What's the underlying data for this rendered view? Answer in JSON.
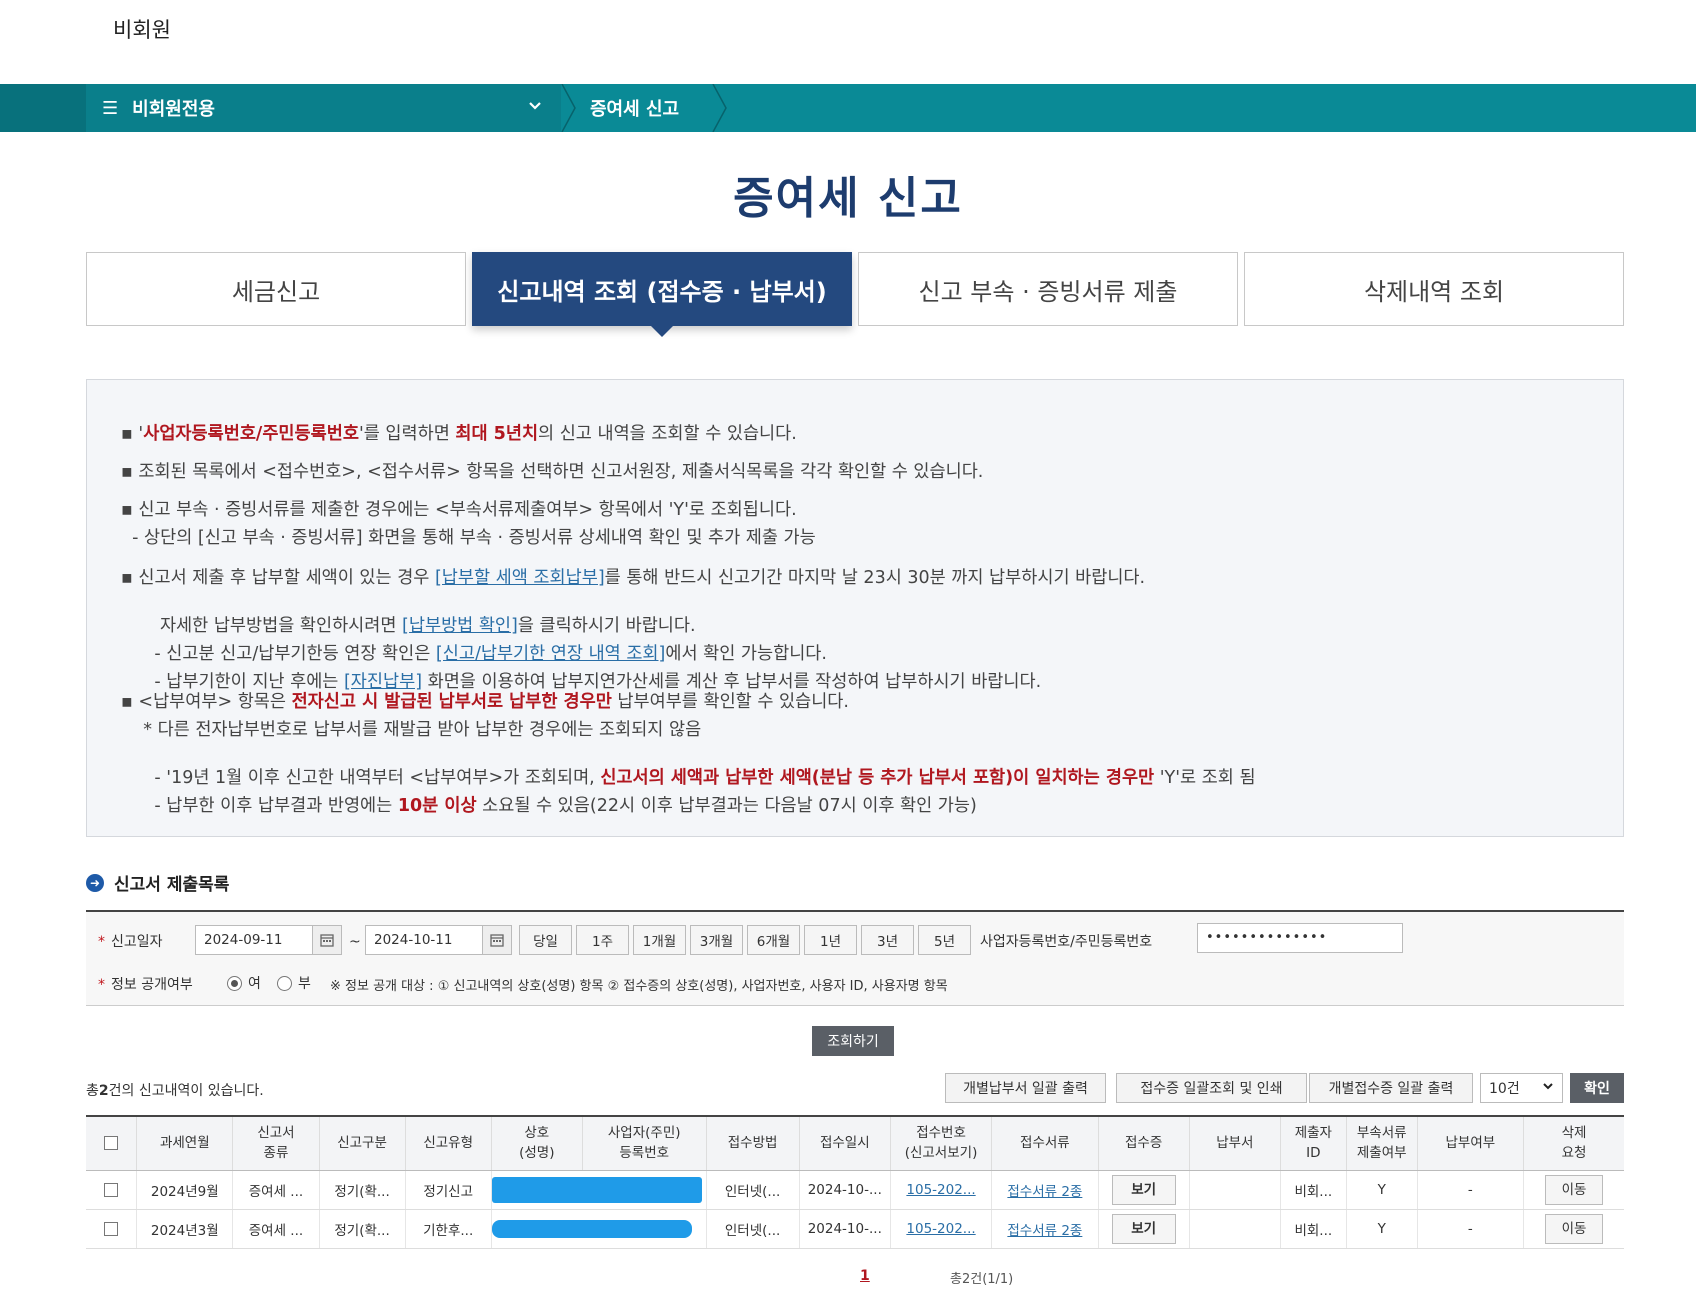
{
  "header": {
    "user_label": "비회원"
  },
  "nav": {
    "menu_label": "비회원전용",
    "current": "증여세 신고"
  },
  "page_title": "증여세 신고",
  "tabs": [
    {
      "label": "세금신고",
      "active": false
    },
    {
      "label": "신고내역 조회 (접수증 · 납부서)",
      "active": true
    },
    {
      "label": "신고 부속 · 증빙서류 제출",
      "active": false
    },
    {
      "label": "삭제내역 조회",
      "active": false
    }
  ],
  "info": {
    "l1_pre": "▪ '",
    "l1_red1": "사업자등록번호/주민등록번호",
    "l1_mid": "'를 입력하면 ",
    "l1_red2": "최대 5년치",
    "l1_post": "의 신고 내역을 조회할 수 있습니다.",
    "l2": "▪ 조회된 목록에서 <접수번호>, <접수서류> 항목을 선택하면 신고서원장, 제출서식목록을 각각 확인할 수 있습니다.",
    "l3": "▪ 신고 부속 · 증빙서류를 제출한 경우에는 <부속서류제출여부> 항목에서 'Y'로 조회됩니다.",
    "l4": "  - 상단의 [신고 부속 · 증빙서류] 화면을 통해 부속 · 증빙서류 상세내역 확인 및 추가 제출 가능",
    "l5_pre": "▪ 신고서 제출 후 납부할 세액이 있는 경우 ",
    "l5_link": "[납부할 세액 조회납부]",
    "l5_post": "를 통해 반드시 신고기간 마지막 날 23시 30분 까지 납부하시기 바랍니다.",
    "l6_pre": "   자세한 납부방법을 확인하시려면 ",
    "l6_link": "[납부방법 확인]",
    "l6_post": "을 클릭하시기 바랍니다.",
    "l7_pre": "  - 신고분 신고/납부기한등 연장 확인은 ",
    "l7_link": "[신고/납부기한 연장 내역 조회]",
    "l7_post": "에서 확인 가능합니다.",
    "l8_pre": "  - 납부기한이 지난 후에는 ",
    "l8_link": "[자진납부]",
    "l8_post": " 화면을 이용하여 납부지연가산세를 계산 후 납부서를 작성하여 납부하시기 바랍니다.",
    "l9_pre": "▪ <납부여부> 항목은 ",
    "l9_red": "전자신고 시 발급된 납부서로 납부한 경우만",
    "l9_post": " 납부여부를 확인할 수 있습니다.",
    "l10": "    * 다른 전자납부번호로 납부서를 재발급 받아 납부한 경우에는 조회되지 않음",
    "l11_pre": "  - '19년 1월 이후 신고한 내역부터 <납부여부>가 조회되며, ",
    "l11_red": "신고서의 세액과 납부한 세액(분납 등 추가 납부서 포함)이 일치하는 경우만",
    "l11_post": " 'Y'로 조회 됨",
    "l12_pre": "  - 납부한 이후 납부결과 반영에는 ",
    "l12_red": "10분 이상",
    "l12_post": " 소요될 수 있음(22시 이후 납부결과는 다음날 07시 이후 확인 가능)"
  },
  "section_title": "신고서 제출목록",
  "search": {
    "date_label": "신고일자",
    "date_from": "2024-09-11",
    "date_to": "2024-10-11",
    "tilde": "~",
    "periods": [
      "당일",
      "1주",
      "1개월",
      "3개월",
      "6개월",
      "1년",
      "3년",
      "5년"
    ],
    "id_label": "사업자등록번호/주민등록번호",
    "id_value": "••••••••••••••",
    "public_label": "정보 공개여부",
    "yes_label": "여",
    "no_label": "부",
    "public_note": "※ 정보 공개 대상 : ① 신고내역의 상호(성명) 항목 ② 접수증의 상호(성명), 사업자번호, 사용자 ID, 사용자명 항목",
    "search_button": "조회하기"
  },
  "results": {
    "count_pre": "총",
    "count_num": "2",
    "count_post": "건의 신고내역이 있습니다.",
    "btn_bulk_payment": "개별납부서 일괄 출력",
    "btn_bulk_receipt": "접수증 일괄조회 및 인쇄",
    "btn_individual_receipt": "개별접수증 일괄 출력",
    "page_size": "10건",
    "confirm": "확인",
    "headers": [
      "",
      "과세연월",
      "신고서\n종류",
      "신고구분",
      "신고유형",
      "상호\n(성명)",
      "사업자(주민)\n등록번호",
      "접수방법",
      "접수일시",
      "접수번호\n(신고서보기)",
      "접수서류",
      "접수증",
      "납부서",
      "제출자\nID",
      "부속서류\n제출여부",
      "납부여부",
      "삭제\n요청"
    ],
    "rows": [
      {
        "period": "2024년9월",
        "kind": "증여세 ...",
        "type": "정기(확...",
        "form": "정기신고",
        "method": "인터넷(...",
        "date": "2024-10-...",
        "receipt_no": "105-202...",
        "docs": "접수서류 2종",
        "view": "보기",
        "payment": "",
        "submitter": "비회...",
        "attach": "Y",
        "paid": "-",
        "move": "이동"
      },
      {
        "period": "2024년3월",
        "kind": "증여세 ...",
        "type": "정기(확...",
        "form": "기한후...",
        "method": "인터넷(...",
        "date": "2024-10-...",
        "receipt_no": "105-202...",
        "docs": "접수서류 2종",
        "view": "보기",
        "payment": "",
        "submitter": "비회...",
        "attach": "Y",
        "paid": "-",
        "move": "이동"
      }
    ],
    "pager_current": "1",
    "pager_total": "총2건(1/1)"
  },
  "colors": {
    "nav_bg": "#0a8a96",
    "tab_active": "#24497f",
    "title": "#1d3c6e",
    "emphasis_red": "#b0171f",
    "link_blue": "#2a6ea6"
  }
}
